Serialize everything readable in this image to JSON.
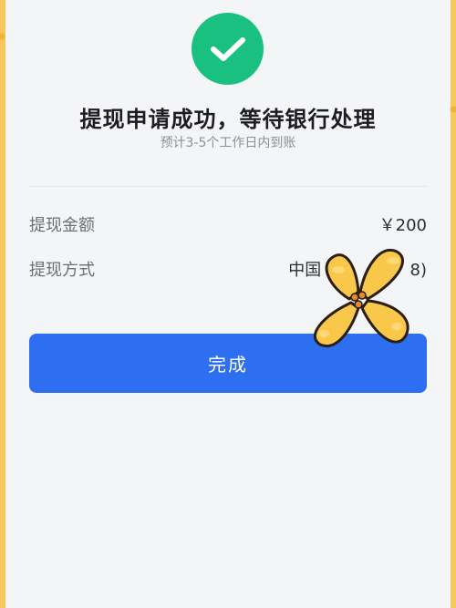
{
  "result": {
    "title": "提现申请成功，等待银行处理",
    "subtitle": "预计3-5个工作日内到账"
  },
  "details": {
    "amount_label": "提现金额",
    "amount_value": "￥200",
    "method_label": "提现方式",
    "method_value": "中国                 8)"
  },
  "actions": {
    "done_label": "完成"
  },
  "colors": {
    "success": "#19c07f",
    "primary": "#2e6ff2",
    "background": "#f4f5f7",
    "sticker_fill": "#f9c84a"
  },
  "icons": {
    "status": "check-icon",
    "overlay": "flower-sticker"
  }
}
